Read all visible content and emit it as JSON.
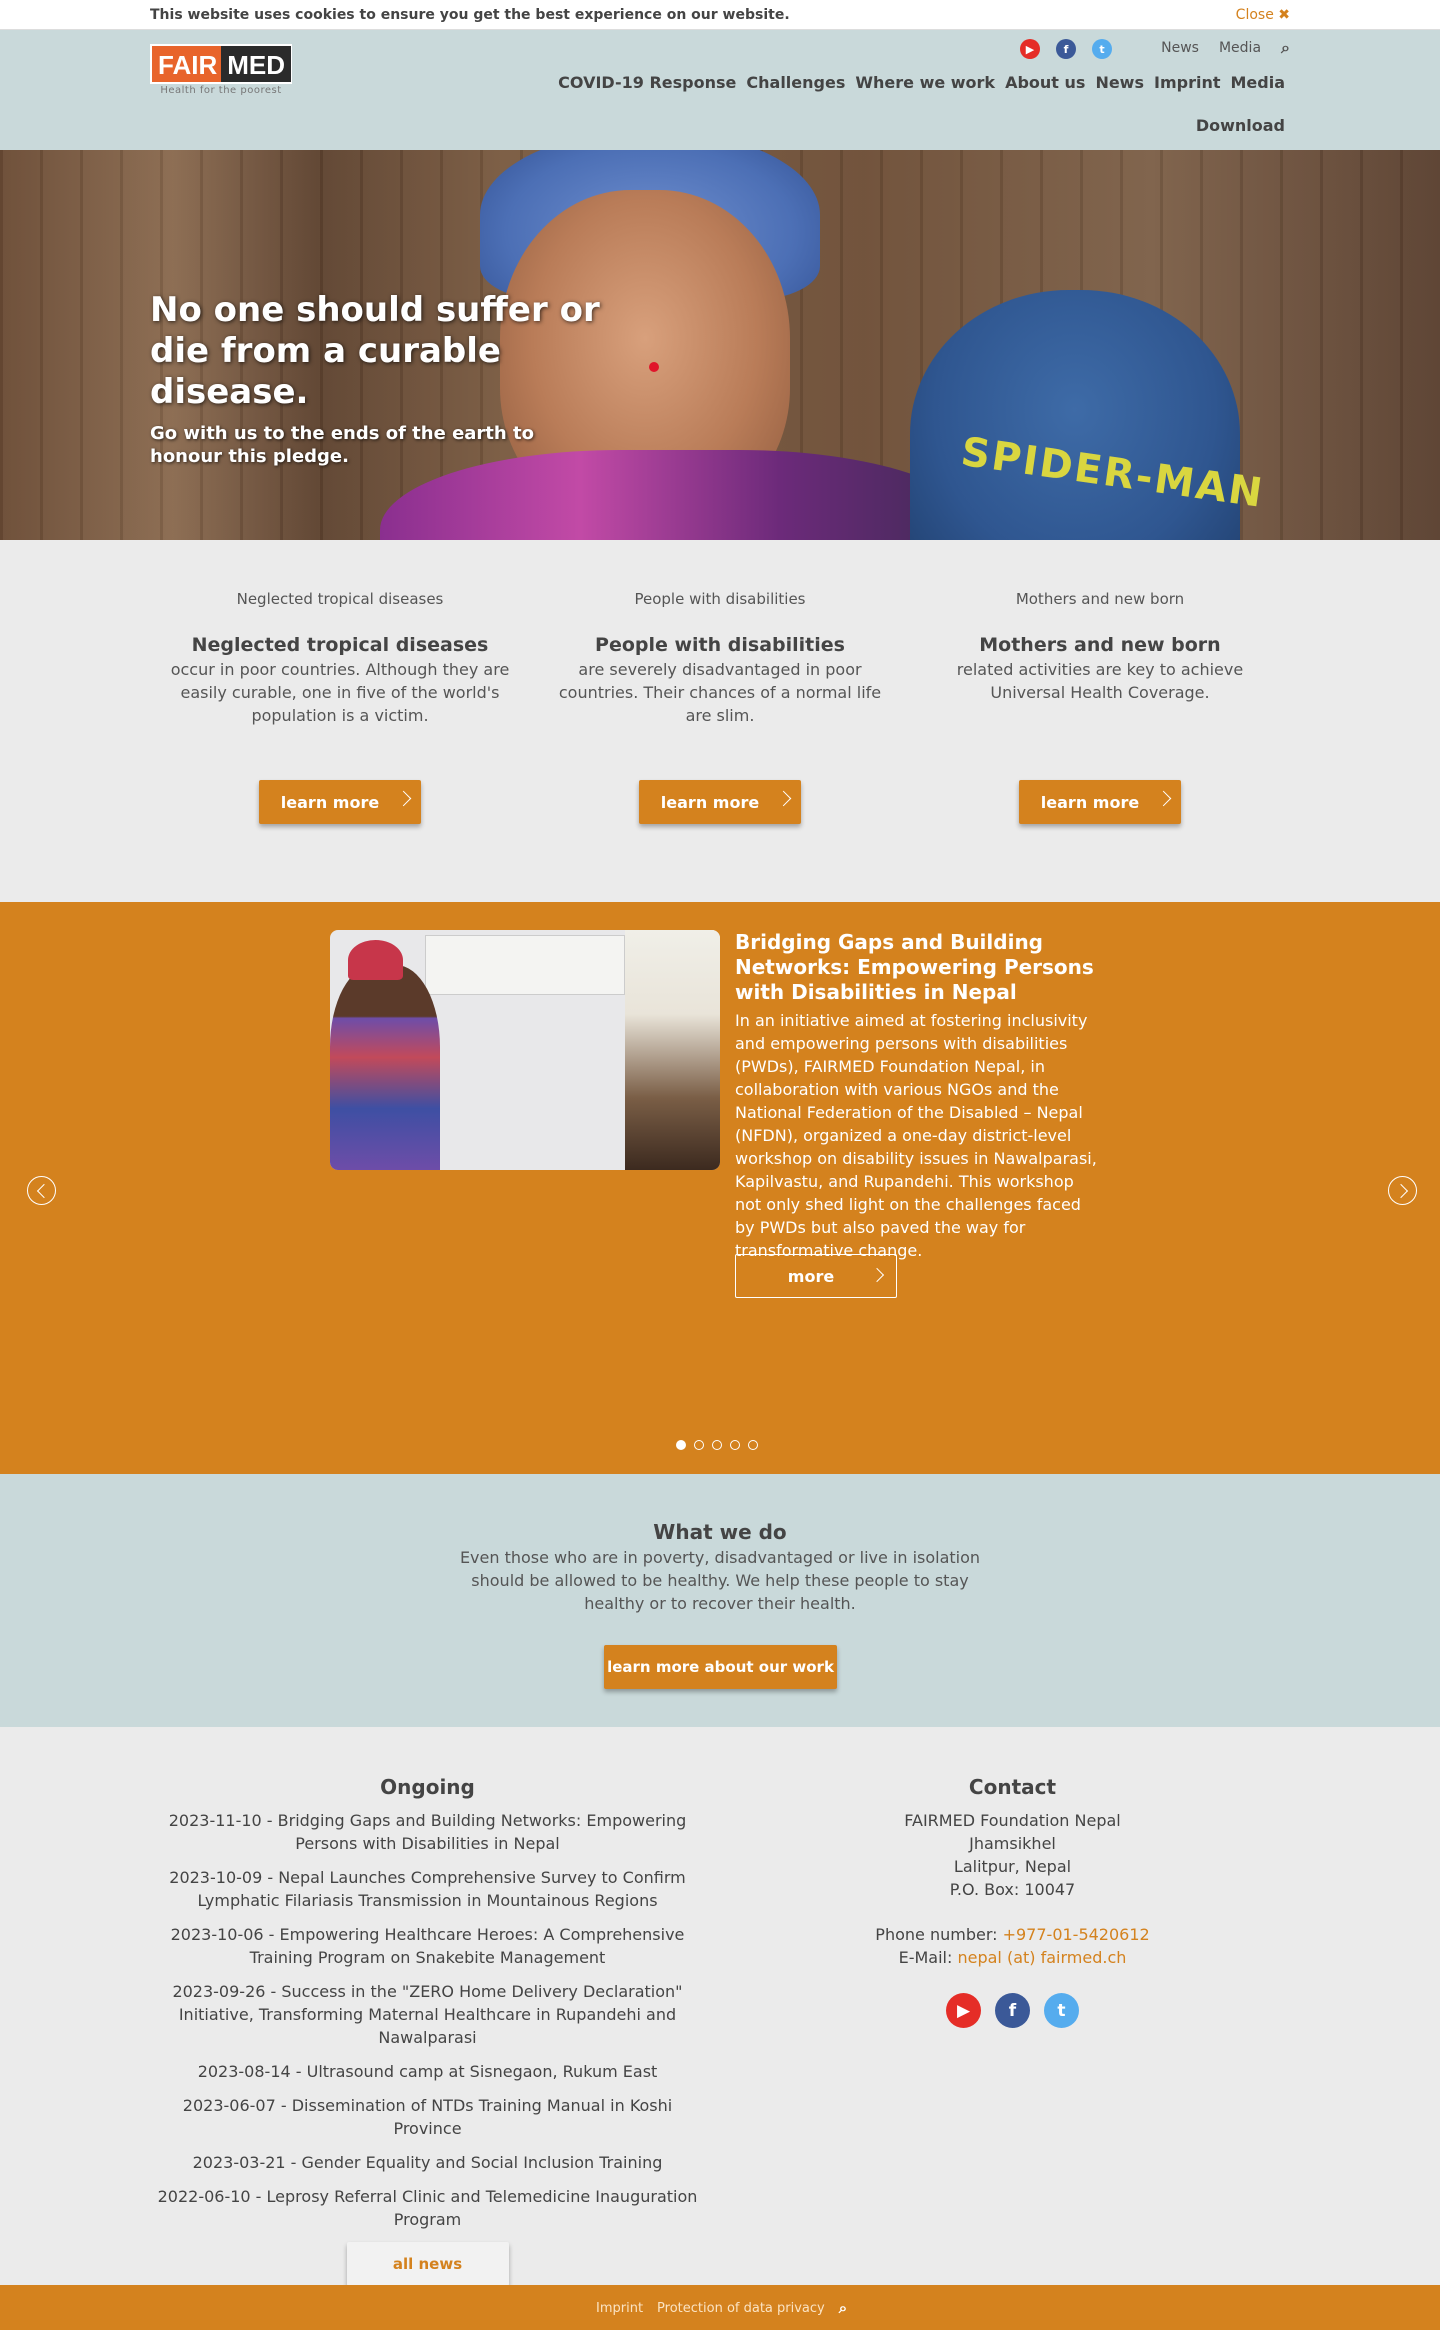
{
  "cookie": {
    "message": "This website uses cookies to ensure you get the best experience on our website.",
    "close_label": "Close ✖"
  },
  "logo": {
    "fair": "FAIR",
    "med": "MED",
    "tagline": "Health for the poorest"
  },
  "meta_nav": {
    "items": [
      "News",
      "Media"
    ],
    "search_icon": "⌕"
  },
  "social_icons": {
    "youtube": "▶",
    "facebook": "f",
    "twitter": "t"
  },
  "main_nav": {
    "items": [
      "COVID-19 Response",
      "Challenges",
      "Where we work",
      "About us",
      "News",
      "Imprint",
      "Media"
    ],
    "second_row": "Download"
  },
  "hero": {
    "title": "No one should suffer or die from a curable disease.",
    "subtitle": "Go with us to the ends of the earth to honour this pledge.",
    "hat_text": "SPIDER-MAN"
  },
  "features": [
    {
      "img_alt": "Neglected tropical diseases",
      "title": "Neglected tropical diseases",
      "text": "occur in poor countries. Although they are easily curable, one in five of the world's population is a victim.",
      "button": "learn more"
    },
    {
      "img_alt": "People with disabilities",
      "title": "People with disabilities",
      "text": "are severely disadvantaged in poor countries. Their chances of a normal life are slim.",
      "button": "learn more"
    },
    {
      "img_alt": "Mothers and new born",
      "title": "Mothers and new born",
      "text": "related activities are key to achieve Universal Health Coverage.",
      "button": "learn more"
    }
  ],
  "slider": {
    "title": "Bridging Gaps and Building Networks: Empowering Persons with Disabilities in Nepal",
    "text": "In an initiative aimed at fostering inclusivity and empowering persons with disabilities (PWDs), FAIRMED Foundation Nepal, in collaboration with various NGOs and the National Federation of the Disabled – Nepal (NFDN), organized a one-day district-level workshop on disability issues in Nawalparasi, Kapilvastu, and Rupandehi. This workshop not only shed light on the challenges faced by PWDs but also paved the way for transformative change.",
    "more_label": "more",
    "slide_count": 5,
    "active_slide": 1
  },
  "what_we_do": {
    "title": "What we do",
    "text": "Even those who are in poverty, disadvantaged or live in isolation should be allowed to be healthy. We help these people to stay healthy or to recover their health.",
    "button": "learn more about our work"
  },
  "news": {
    "title": "Ongoing",
    "items": [
      "2023-11-10 - Bridging Gaps and Building Networks: Empowering Persons with Disabilities in Nepal",
      "2023-10-09 - Nepal Launches Comprehensive Survey to Confirm Lymphatic Filariasis Transmission in Mountainous Regions",
      "2023-10-06 - Empowering Healthcare Heroes: A Comprehensive Training Program on Snakebite Management",
      "2023-09-26 - Success in the \"ZERO Home Delivery Declaration\" Initiative, Transforming Maternal Healthcare in Rupandehi and Nawalparasi",
      "2023-08-14 - Ultrasound camp at Sisnegaon, Rukum East",
      "2023-06-07 - Dissemination of NTDs Training Manual in Koshi Province",
      "2023-03-21 - Gender Equality and Social Inclusion Training",
      "2022-06-10 - Leprosy Referral Clinic and Telemedicine Inauguration Program"
    ],
    "all_news_label": "all news"
  },
  "contact": {
    "title": "Contact",
    "address": [
      "FAIRMED Foundation Nepal",
      "Jhamsikhel",
      "Lalitpur, Nepal",
      "P.O. Box: 10047"
    ],
    "phone_label": "Phone number:",
    "phone": "+977-01-5420612",
    "email_label": "E-Mail:",
    "email": "nepal (at) fairmed.ch"
  },
  "footer": {
    "links": [
      "Imprint",
      "Protection of data privacy"
    ],
    "search_icon": "⌕"
  },
  "colors": {
    "accent": "#d4821e",
    "header_bg": "#c9d9da",
    "page_bg": "#ebebeb"
  }
}
